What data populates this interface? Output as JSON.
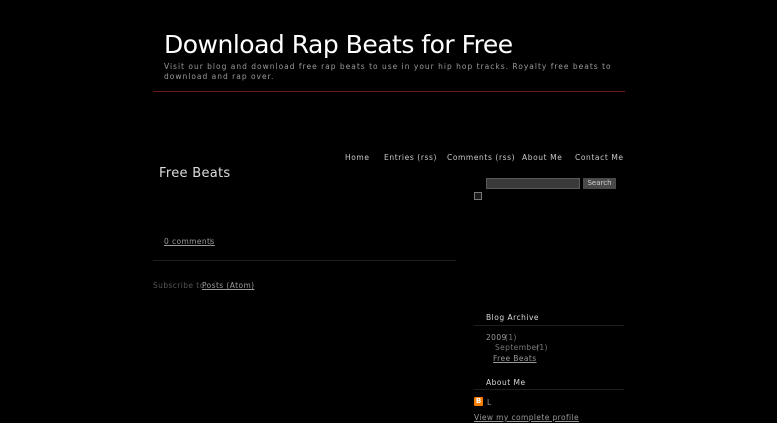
{
  "header": {
    "title": "Download Rap Beats for Free",
    "description": "Visit our blog and download free rap beats to use in your hip hop tracks. Royalty free beats to download and rap over."
  },
  "nav": {
    "home": "Home",
    "entries": "Entries (rss)",
    "comments": "Comments (rss)",
    "about": "About Me",
    "contact": "Contact Me"
  },
  "post": {
    "title": "Free Beats",
    "comments_link": "0 comments",
    "comments_sep": "|"
  },
  "footer": {
    "subscribe_label": "Subscribe to:",
    "subscribe_link": "Posts (Atom)"
  },
  "sidebar": {
    "search": {
      "value": "",
      "button_label": "Search"
    },
    "archive": {
      "title": "Blog Archive",
      "year": "2009",
      "year_count": "(1)",
      "month": "September",
      "month_count": "(1)",
      "post_link": "Free Beats"
    },
    "about": {
      "title": "About Me",
      "name": "L",
      "profile_link": "View my complete profile"
    }
  },
  "colors": {
    "background": "#000000",
    "header_rule": "#6b1a14",
    "blogger_orange": "#f57d00"
  },
  "icons": {
    "blogger": "blogger-icon",
    "broken_image": "broken-image-icon"
  }
}
